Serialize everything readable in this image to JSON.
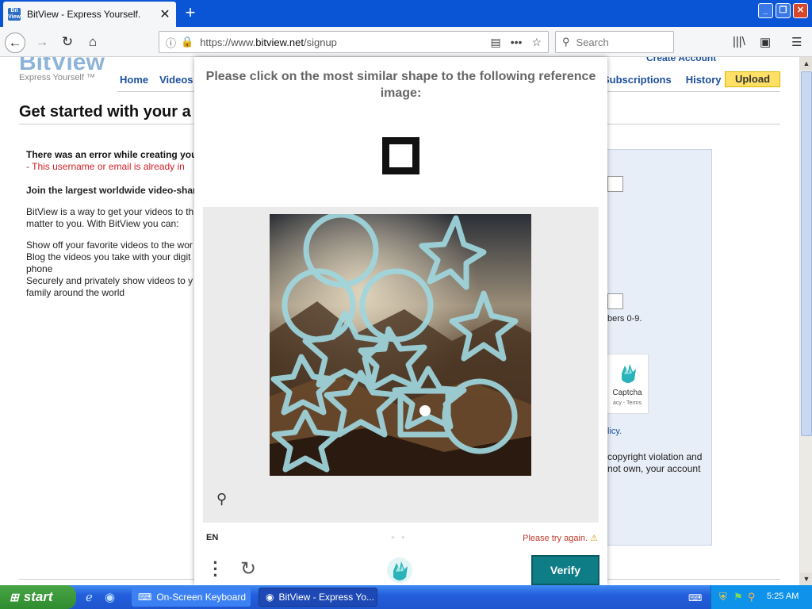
{
  "browser": {
    "tab_title": "BitView - Express Yourself.",
    "favicon_text": "Bit View",
    "url_prefix": "https://www.",
    "url_domain": "bitview.net",
    "url_path": "/signup",
    "search_placeholder": "Search"
  },
  "site": {
    "logo": "BitView",
    "tagline": "Express Yourself ™",
    "create_account": "Create Account",
    "nav_left": [
      "Home",
      "Videos"
    ],
    "nav_right": [
      "Subscriptions",
      "History"
    ],
    "upload_label": "Upload",
    "page_heading": "Get started with your a",
    "error_title": "There was an error while creating you",
    "error_message": "- This username or email is already in",
    "join_title": "Join the largest worldwide video-shar",
    "intro_lines": [
      "BitView is a way to get your videos to th",
      "matter to you. With BitView you can:"
    ],
    "feature_lines": [
      "Show off your favorite videos to the wor",
      "Blog the videos you take with your digit",
      "phone",
      "Securely and privately show videos to y",
      "family around the world"
    ],
    "numbers_hint": "bers 0-9.",
    "captcha_badge_label": "Captcha",
    "captcha_badge_sub": "acy - Terms",
    "policy_link": "licy.",
    "copyright_lines": [
      "copyright violation and",
      "not own, your account"
    ]
  },
  "captcha": {
    "prompt": "Please click on the most similar shape to the following reference image:",
    "language": "EN",
    "retry_message": "Please try again.",
    "verify_label": "Verify",
    "accent_color": "#0f7d86",
    "reference_shape": "square"
  },
  "taskbar": {
    "start_label": "start",
    "items": [
      "On-Screen Keyboard",
      "BitView - Express Yo..."
    ],
    "clock": "5:25 AM"
  }
}
